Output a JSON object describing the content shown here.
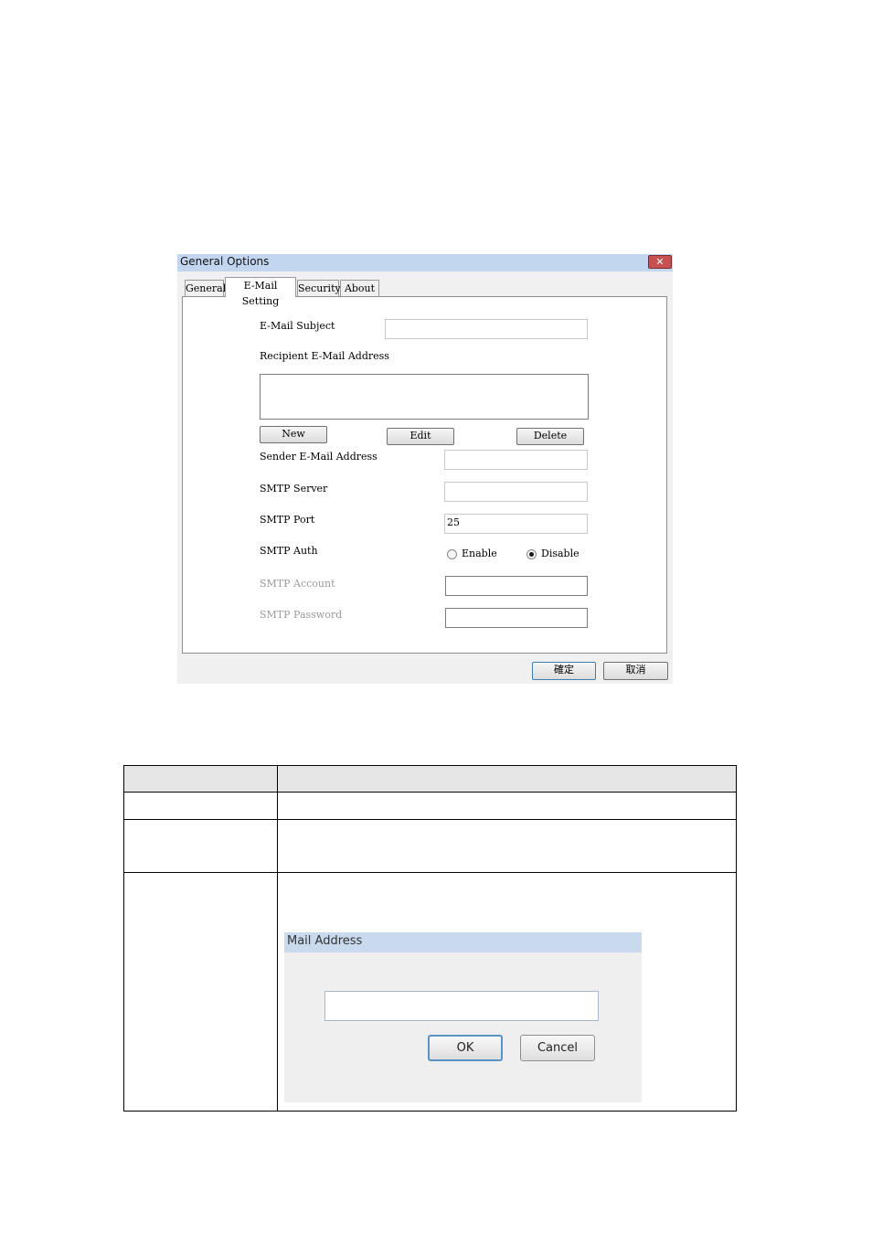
{
  "general_options": {
    "title": "General Options",
    "close_label": "✕",
    "tabs": [
      {
        "label": "General"
      },
      {
        "label": "E-Mail Setting"
      },
      {
        "label": "Security"
      },
      {
        "label": "About"
      }
    ],
    "active_tab": "E-Mail Setting",
    "email_subject": {
      "label": "E-Mail Subject",
      "value": ""
    },
    "recipient": {
      "label": "Recipient E-Mail Address",
      "list": []
    },
    "buttons": {
      "new": "New",
      "edit": "Edit",
      "delete": "Delete"
    },
    "sender": {
      "label": "Sender E-Mail Address",
      "value": ""
    },
    "smtp_server": {
      "label": "SMTP Server",
      "value": ""
    },
    "smtp_port": {
      "label": "SMTP Port",
      "value": "25"
    },
    "smtp_auth": {
      "label": "SMTP Auth",
      "enable": "Enable",
      "disable": "Disable",
      "selected": "Disable"
    },
    "smtp_account": {
      "label": "SMTP Account",
      "value": ""
    },
    "smtp_password": {
      "label": "SMTP Password",
      "value": ""
    },
    "ok_label": "確定",
    "cancel_label": "取消"
  },
  "mail_dialog": {
    "title": "Mail Address",
    "value": "",
    "ok_label": "OK",
    "cancel_label": "Cancel"
  }
}
